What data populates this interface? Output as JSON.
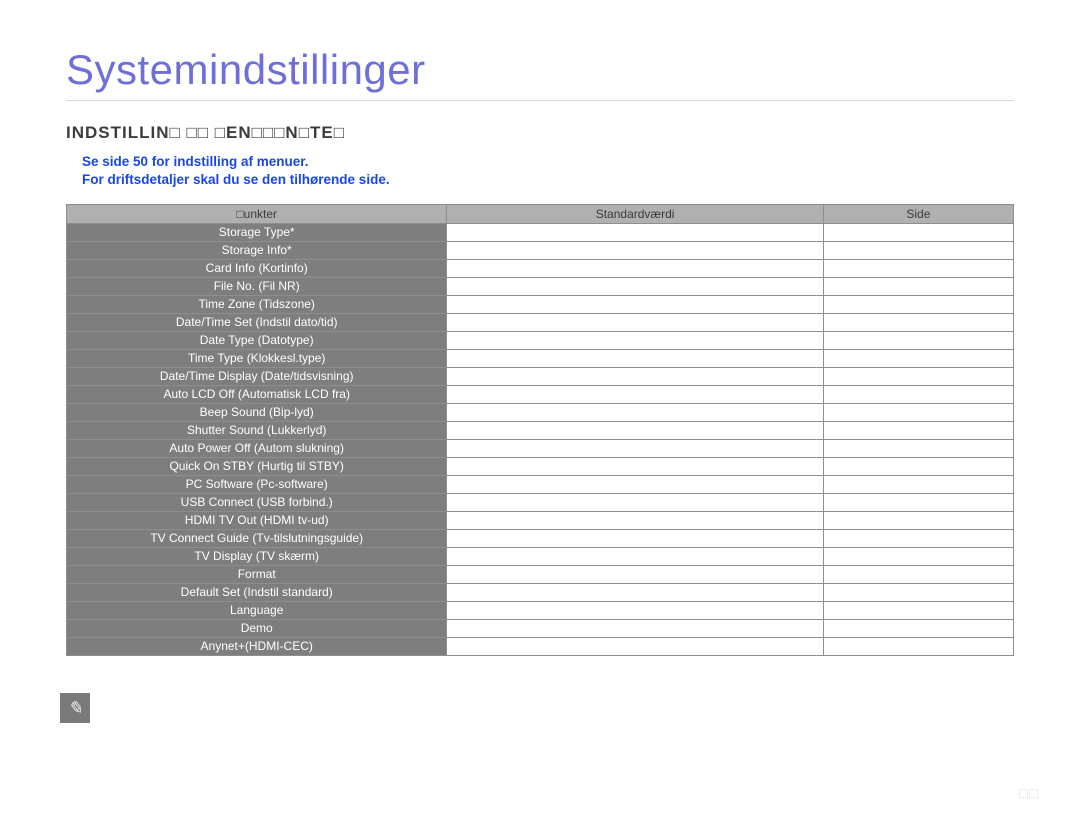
{
  "title": "Systemindstillinger",
  "sectionHeading": "INDSTILLIN□ □□ □EN□□□N□TE□",
  "introLine1": "Se side 50 for indstilling af menuer.",
  "introLine2": "For driftsdetaljer skal du se den tilhørende side.",
  "headers": {
    "item": "□unkter",
    "value": "Standardværdi",
    "page": "Side"
  },
  "rows": [
    {
      "item": "Storage Type*",
      "value": "",
      "page": ""
    },
    {
      "item": "Storage Info*",
      "value": "",
      "page": ""
    },
    {
      "item": "Card Info (Kortinfo)",
      "value": "",
      "page": ""
    },
    {
      "item": "File No. (Fil NR)",
      "value": "",
      "page": ""
    },
    {
      "item": "Time Zone (Tidszone)",
      "value": "",
      "page": ""
    },
    {
      "item": "Date/Time Set (Indstil dato/tid)",
      "value": "",
      "page": ""
    },
    {
      "item": "Date Type (Datotype)",
      "value": "",
      "page": ""
    },
    {
      "item": "Time Type (Klokkesl.type)",
      "value": "",
      "page": ""
    },
    {
      "item": "Date/Time Display (Date/tidsvisning)",
      "value": "",
      "page": ""
    },
    {
      "item": "Auto LCD Off (Automatisk LCD fra)",
      "value": "",
      "page": ""
    },
    {
      "item": "Beep Sound (Bip-lyd)",
      "value": "",
      "page": ""
    },
    {
      "item": "Shutter Sound (Lukkerlyd)",
      "value": "",
      "page": ""
    },
    {
      "item": "Auto Power Off (Autom slukning)",
      "value": "",
      "page": ""
    },
    {
      "item": "Quick On STBY (Hurtig til STBY)",
      "value": "",
      "page": ""
    },
    {
      "item": "PC Software (Pc-software)",
      "value": "",
      "page": ""
    },
    {
      "item": "USB Connect (USB forbind.)",
      "value": "",
      "page": ""
    },
    {
      "item": "HDMI TV Out (HDMI tv-ud)",
      "value": "",
      "page": ""
    },
    {
      "item": "TV Connect Guide (Tv-tilslutningsguide)",
      "value": "",
      "page": ""
    },
    {
      "item": "TV Display (TV skærm)",
      "value": "",
      "page": ""
    },
    {
      "item": "Format",
      "value": "",
      "page": ""
    },
    {
      "item": "Default Set (Indstil standard)",
      "value": "",
      "page": ""
    },
    {
      "item": "Language",
      "value": "",
      "page": ""
    },
    {
      "item": "Demo",
      "value": "",
      "page": ""
    },
    {
      "item": "Anynet+(HDMI-CEC)",
      "value": "",
      "page": ""
    }
  ],
  "noteIconGlyph": "✎",
  "pageNumber": "□□"
}
